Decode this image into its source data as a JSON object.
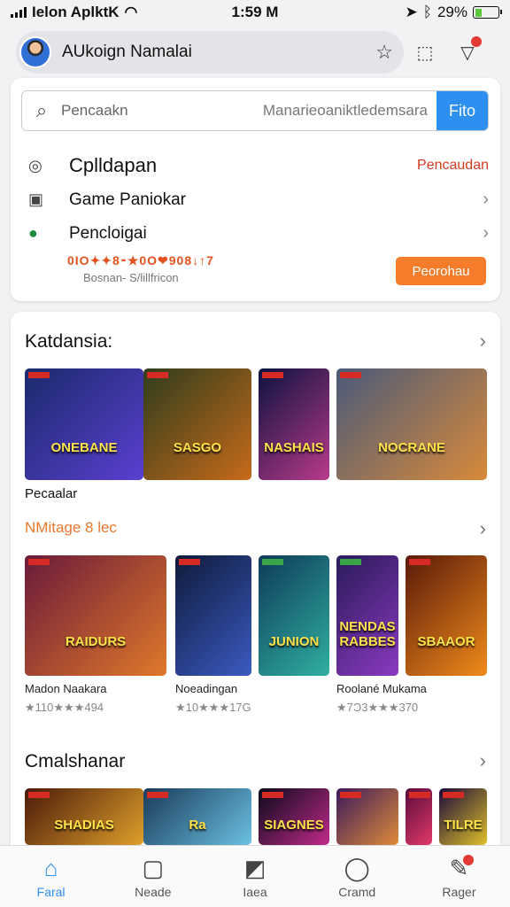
{
  "status": {
    "carrier": "Ielon AplktK",
    "time": "1:59 M",
    "battery": "29%",
    "battery_level": 0.29
  },
  "header": {
    "account_name": "AUkoign Namalai",
    "icons": [
      "star-icon",
      "tag-icon",
      "wishlist-icon"
    ]
  },
  "search": {
    "label": "Pencaakn",
    "placeholder": "Manarieoaniktledemsara",
    "button": "Fito"
  },
  "menu": [
    {
      "label": "Cplldapan",
      "side": "Pencaudan",
      "icon": "location-icon"
    },
    {
      "label": "Game Paniokar",
      "icon": "gamepad-icon"
    },
    {
      "label": "Pencloigai",
      "icon": "chat-icon"
    }
  ],
  "promo": {
    "line": "0IO✦✦8⁃★0O❤908↓↑7",
    "sub": "Bosnan-  S/lillfricon",
    "button": "Peorohau"
  },
  "section1": {
    "title": "Katdansia:",
    "sub_label": "Pecaalar",
    "orange_label": "NMitage 8 lec",
    "tiles": [
      {
        "title": "ONEBANE",
        "colors": [
          "#1a2a6c",
          "#5a3fd0"
        ]
      },
      {
        "title": "SASGO",
        "colors": [
          "#2e3d1c",
          "#c76a1a"
        ]
      },
      {
        "title": "NASHAIS",
        "colors": [
          "#0c1240",
          "#b83a8a"
        ]
      },
      {
        "title": "NOCRANE",
        "colors": [
          "#4a5a7a",
          "#d98a3a"
        ]
      }
    ]
  },
  "section2": {
    "tiles": [
      {
        "title": "RAIDURS",
        "colors": [
          "#6a1a3a",
          "#e0782a"
        ]
      },
      {
        "title": "",
        "colors": [
          "#0f1a3a",
          "#3a5ac0"
        ]
      },
      {
        "title": "JUNION",
        "colors": [
          "#0f3a5a",
          "#2fb0a0"
        ]
      },
      {
        "title": "NENDAS RABBES",
        "colors": [
          "#2a1a5a",
          "#8a3ac0"
        ]
      },
      {
        "title": "SBAAOR",
        "colors": [
          "#5a1a0a",
          "#f08a1a"
        ]
      }
    ],
    "games": [
      {
        "name": "Madon Naakara",
        "rating": "★110★★★494"
      },
      {
        "name": "Noeadingan",
        "rating": "★10★★★17G"
      },
      {
        "name": "Roolané Mukama",
        "rating": "★7Ɔ3★★★370"
      }
    ]
  },
  "section3": {
    "title": "Cmalshanar",
    "tiles": [
      {
        "title": "SHADIAS",
        "colors": [
          "#4a1a0a",
          "#e0a02a"
        ]
      },
      {
        "title": "Ra",
        "colors": [
          "#1a3a5a",
          "#6ac0e0"
        ]
      },
      {
        "title": "SIAGNES",
        "colors": [
          "#0a0a1a",
          "#c02a8a"
        ]
      },
      {
        "title": "",
        "colors": [
          "#3a1a5a",
          "#e08a3a"
        ]
      },
      {
        "title": "",
        "colors": [
          "#5a0a3a",
          "#e03a6a"
        ]
      },
      {
        "title": "TILRE",
        "colors": [
          "#1a0a3a",
          "#e0c02a"
        ]
      }
    ]
  },
  "tabs": [
    {
      "label": "Faral",
      "icon": "home-icon",
      "glyph": "⌂"
    },
    {
      "label": "Neade",
      "icon": "apps-icon",
      "glyph": "▢"
    },
    {
      "label": "Iaea",
      "icon": "activity-icon",
      "glyph": "◩"
    },
    {
      "label": "Cramd",
      "icon": "profile-icon",
      "glyph": "◯"
    },
    {
      "label": "Rager",
      "icon": "notification-icon",
      "glyph": "✎"
    }
  ]
}
